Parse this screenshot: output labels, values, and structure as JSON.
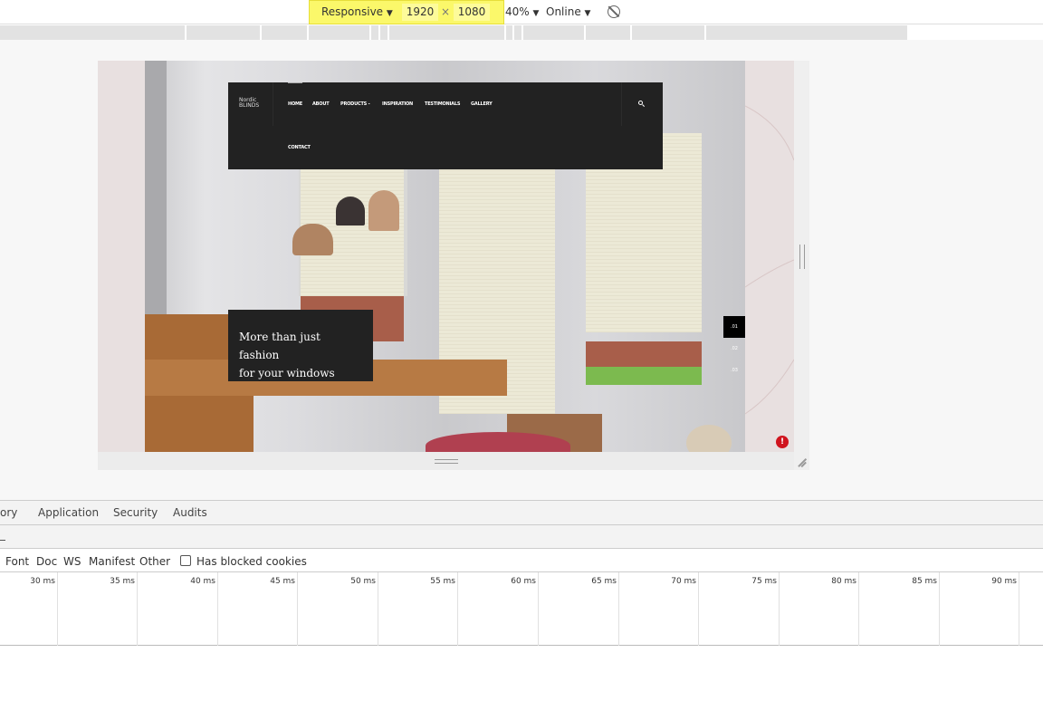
{
  "toolbar": {
    "device": "Responsive",
    "width": "1920",
    "height": "1080",
    "zoom": "40%",
    "network": "Online",
    "dropdown_icon": "▼",
    "times": "×"
  },
  "site": {
    "logo_top": "Nordic",
    "logo_bottom": "BLINDS",
    "nav": [
      "HOME",
      "ABOUT",
      "PRODUCTS -",
      "INSPIRATION",
      "TESTIMONIALS",
      "GALLERY",
      "CONTACT"
    ],
    "caption_line1": "More than just fashion",
    "caption_line2": "for your windows",
    "slides": [
      ".01",
      ".02",
      ".03"
    ],
    "alert": "!"
  },
  "devtools": {
    "tabs": [
      "ory",
      "Application",
      "Security",
      "Audits"
    ],
    "filters": [
      "Font",
      "Doc",
      "WS",
      "Manifest",
      "Other"
    ],
    "blocked_cookies": "Has blocked cookies",
    "timeline": [
      "30 ms",
      "35 ms",
      "40 ms",
      "45 ms",
      "50 ms",
      "55 ms",
      "60 ms",
      "65 ms",
      "70 ms",
      "75 ms",
      "80 ms",
      "85 ms",
      "90 ms"
    ]
  }
}
